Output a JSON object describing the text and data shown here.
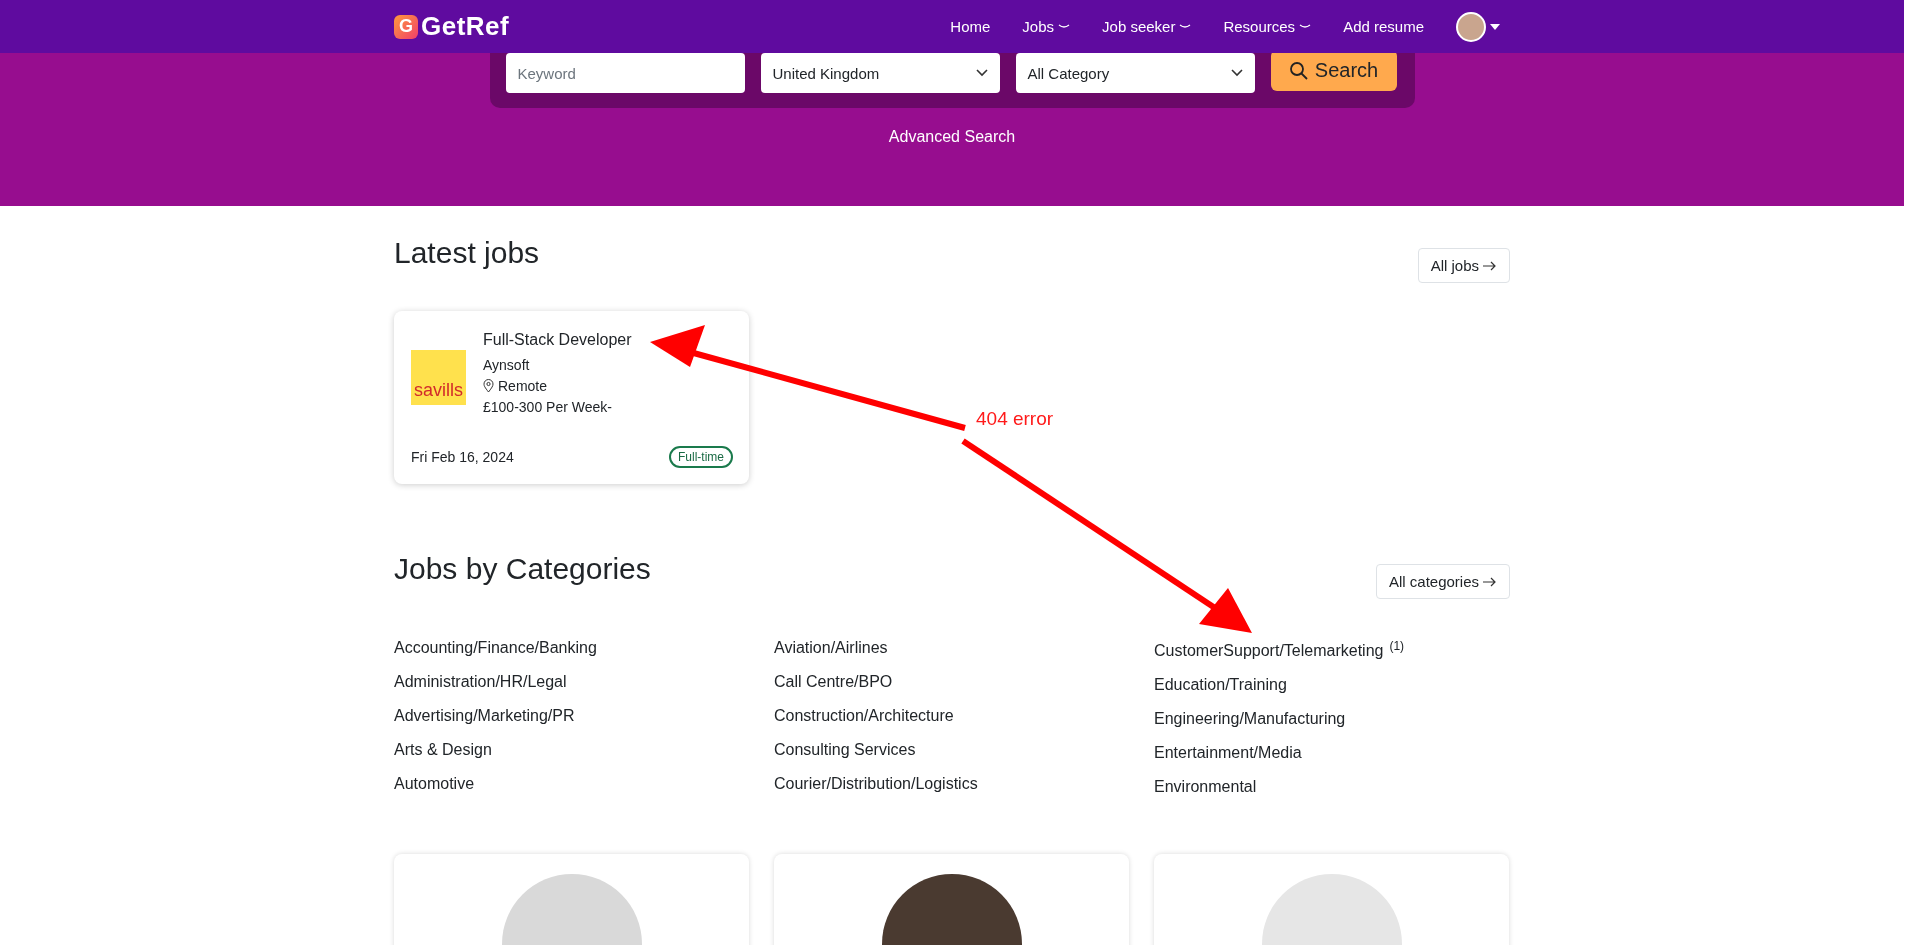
{
  "nav": {
    "logo_mark": "G",
    "logo_text": "GetRef",
    "items": [
      {
        "label": "Home",
        "dropdown": false
      },
      {
        "label": "Jobs",
        "dropdown": true
      },
      {
        "label": "Job seeker",
        "dropdown": true
      },
      {
        "label": "Resources",
        "dropdown": true
      },
      {
        "label": "Add resume",
        "dropdown": false
      }
    ],
    "user_menu": true
  },
  "search": {
    "keyword": {
      "placeholder": "Keyword"
    },
    "country": {
      "value": "United Kingdom"
    },
    "category": {
      "value": "All Category"
    },
    "button": "Search",
    "advanced": "Advanced Search"
  },
  "latest_jobs": {
    "title": "Latest jobs",
    "more": "All jobs",
    "jobs": [
      {
        "logo_text": "savills",
        "title": "Full-Stack Developer",
        "company": "Aynsoft",
        "location": "Remote",
        "salary": "£100-300 Per Week-",
        "date": "Fri Feb 16, 2024",
        "job_type": "Full-time"
      }
    ]
  },
  "categories": {
    "title": "Jobs by Categories",
    "more": "All categories",
    "columns": [
      [
        {
          "name": "Accounting/Finance/Banking"
        },
        {
          "name": "Administration/HR/Legal"
        },
        {
          "name": "Advertising/Marketing/PR"
        },
        {
          "name": "Arts & Design"
        },
        {
          "name": "Automotive"
        }
      ],
      [
        {
          "name": "Aviation/Airlines"
        },
        {
          "name": "Call Centre/BPO"
        },
        {
          "name": "Construction/Architecture"
        },
        {
          "name": "Consulting Services"
        },
        {
          "name": "Courier/Distribution/Logistics"
        }
      ],
      [
        {
          "name": "CustomerSupport/Telemarketing",
          "count": "(1)"
        },
        {
          "name": "Education/Training"
        },
        {
          "name": "Engineering/Manufacturing"
        },
        {
          "name": "Entertainment/Media"
        },
        {
          "name": "Environmental"
        }
      ]
    ]
  },
  "profiles": [
    {
      "color": "#d9d9d9"
    },
    {
      "color": "#4a3a30"
    },
    {
      "color": "#e6e6e6"
    }
  ],
  "annotation": {
    "label": "404 error"
  }
}
